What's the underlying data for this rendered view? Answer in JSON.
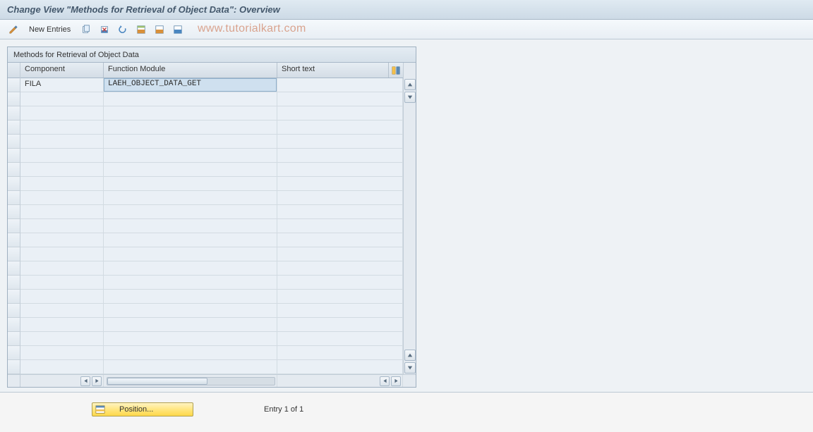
{
  "header": {
    "title": "Change View \"Methods for Retrieval of Object Data\": Overview"
  },
  "toolbar": {
    "new_entries_label": "New Entries"
  },
  "watermark": "www.tutorialkart.com",
  "panel": {
    "title": "Methods for Retrieval of Object Data",
    "columns": {
      "component": "Component",
      "function_module": "Function Module",
      "short_text": "Short text"
    },
    "rows": [
      {
        "component": "FILA",
        "function_module": "LAEH_OBJECT_DATA_GET",
        "short_text": ""
      }
    ],
    "empty_row_count": 20
  },
  "footer": {
    "position_label": "Position...",
    "entry_label": "Entry 1 of 1"
  }
}
